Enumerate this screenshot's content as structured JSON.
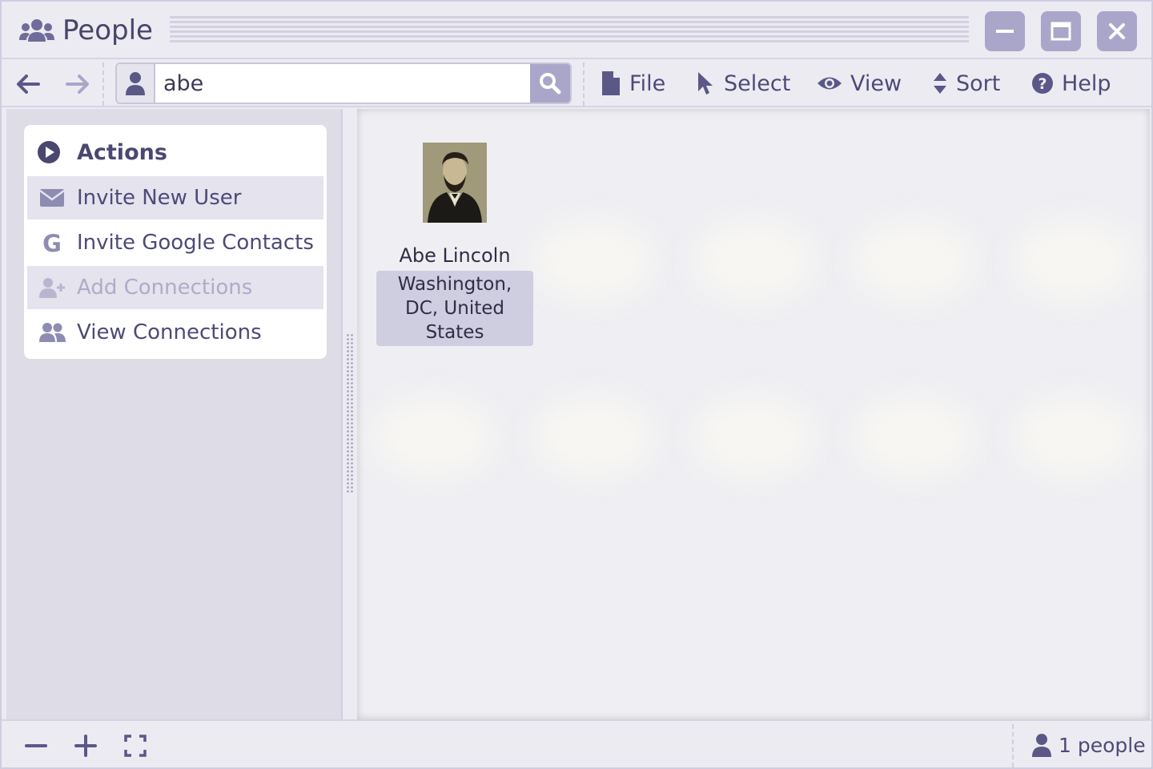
{
  "window": {
    "title": "People"
  },
  "search": {
    "value": "abe"
  },
  "menu": {
    "file": "File",
    "select": "Select",
    "view": "View",
    "sort": "Sort",
    "help": "Help"
  },
  "actions": {
    "header": "Actions",
    "items": [
      {
        "label": "Invite New User",
        "icon": "envelope-icon",
        "disabled": false
      },
      {
        "label": "Invite Google Contacts",
        "icon": "google-icon",
        "disabled": false
      },
      {
        "label": "Add Connections",
        "icon": "user-plus-icon",
        "disabled": true
      },
      {
        "label": "View Connections",
        "icon": "users-icon",
        "disabled": false
      }
    ]
  },
  "people": [
    {
      "name": "Abe Lincoln",
      "location": "Washington, DC, United States"
    }
  ],
  "status": {
    "count_text": "1 people"
  },
  "colors": {
    "accent": "#a9a6c9",
    "text": "#4d4a78",
    "sidebar_bg": "#dddce7",
    "selection": "#cfcde0"
  }
}
